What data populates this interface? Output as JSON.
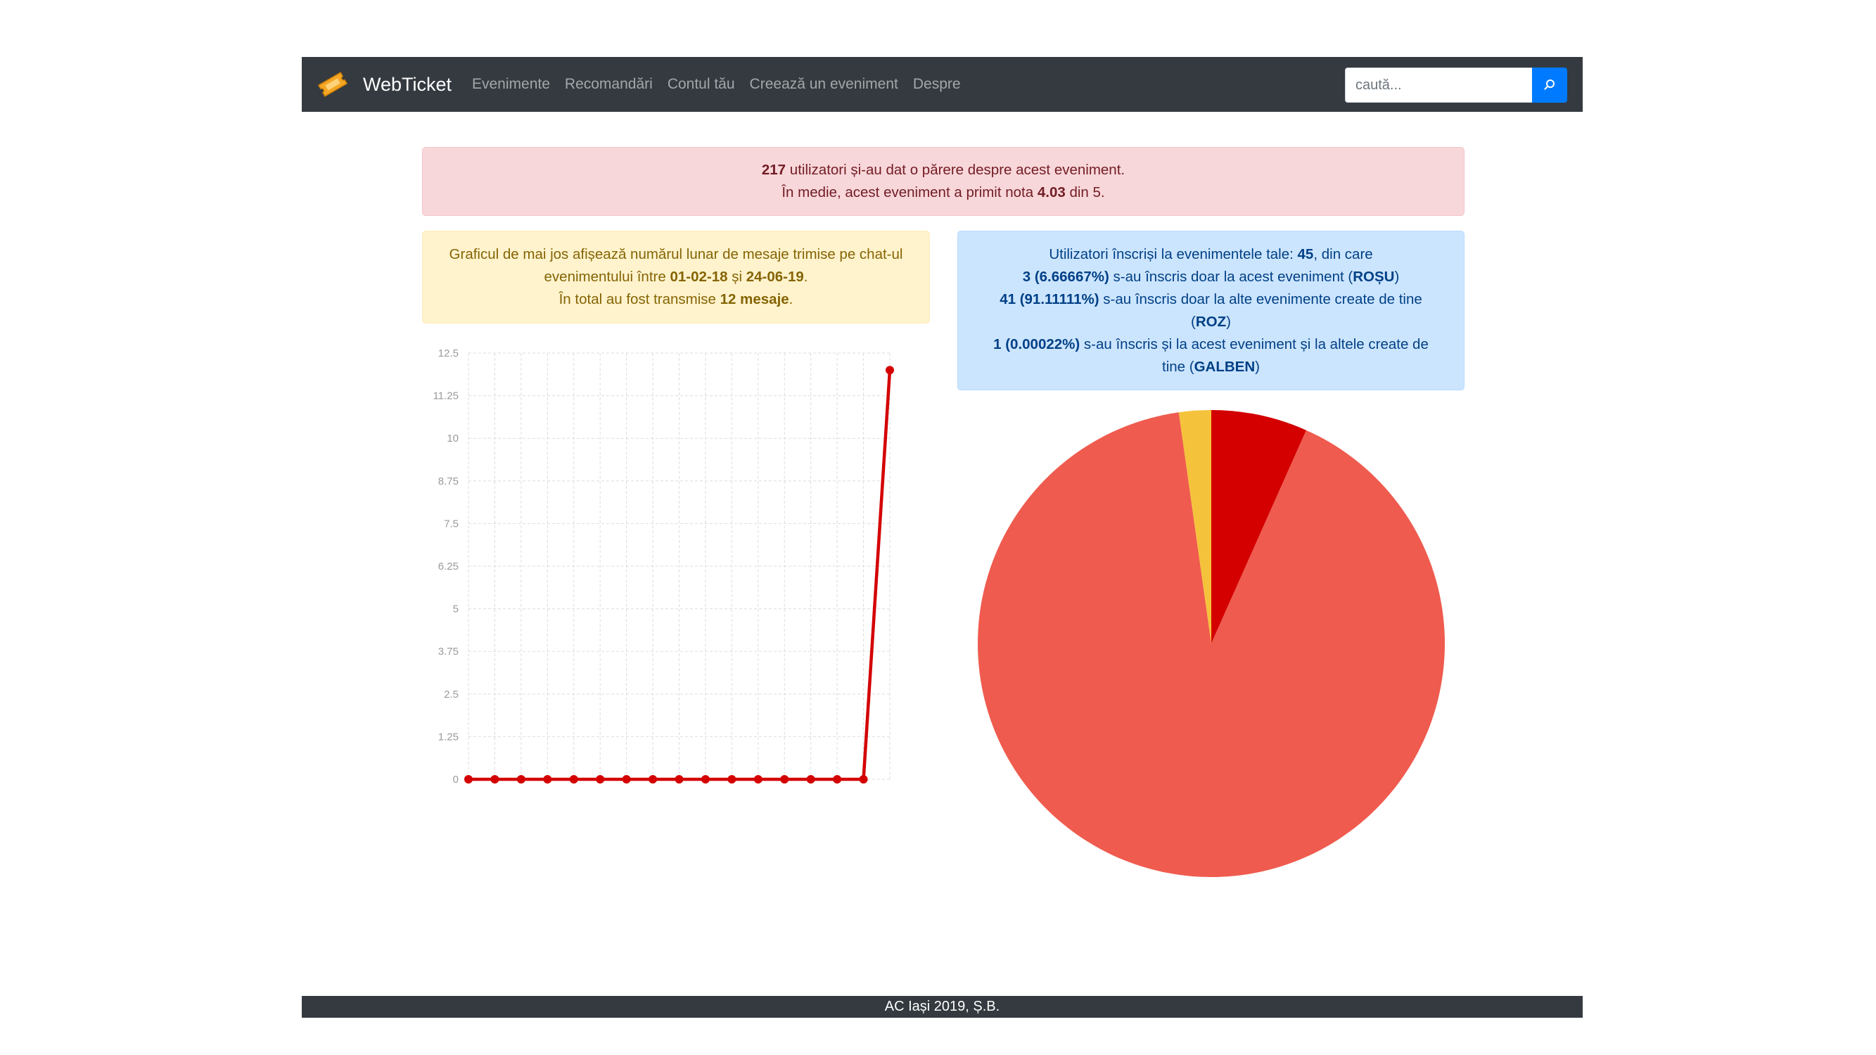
{
  "navbar": {
    "brand": "WebTicket",
    "brand_icon": "ticket-icon",
    "links": [
      "Evenimente",
      "Recomandări",
      "Contul tău",
      "Creează un eveniment",
      "Despre"
    ],
    "search": {
      "placeholder": "caută...",
      "button_icon": "search-icon"
    }
  },
  "rating_alert": {
    "users_count": "217",
    "line1_rest": " utilizatori și-au dat o părere despre acest eveniment.",
    "line2_prefix": "În medie, acest eveniment a primit nota ",
    "average": "4.03",
    "line2_suffix": " din 5."
  },
  "messages_alert": {
    "intro": "Graficul de mai jos afișează numărul lunar de mesaje trimise pe chat-ul evenimentului între ",
    "start_date": "01-02-18",
    "and": " și ",
    "end_date": "24-06-19",
    "period": ".",
    "total_prefix": "În total au fost transmise ",
    "total": "12 mesaje",
    "total_suffix": "."
  },
  "users_alert": {
    "line1_prefix": "Utilizatori înscriși la evenimentele tale: ",
    "total": "45",
    "line1_suffix": ", din care",
    "line2_value": "3 (6.66667%)",
    "line2_text": " s-au înscris doar la acest eveniment (",
    "line2_color": "ROȘU",
    "line3_value": "41 (91.11111%)",
    "line3_text": " s-au înscris doar la alte evenimente create de tine (",
    "line3_color": "ROZ",
    "line4_value": "1 (0.00022%)",
    "line4_text": " s-au înscris și la acest eveniment și la altele create de tine (",
    "line4_color": "GALBEN",
    "close": ")"
  },
  "chart_data": [
    {
      "type": "line",
      "title": "",
      "xlabel": "",
      "ylabel": "",
      "ylim": [
        0,
        12.5
      ],
      "y_ticks": [
        "0",
        "1.25",
        "2.5",
        "3.75",
        "5",
        "6.25",
        "7.5",
        "8.75",
        "10",
        "11.25",
        "12.5"
      ],
      "x": [
        1,
        2,
        3,
        4,
        5,
        6,
        7,
        8,
        9,
        10,
        11,
        12,
        13,
        14,
        15,
        16,
        17
      ],
      "series": [
        {
          "values": [
            0,
            0,
            0,
            0,
            0,
            0,
            0,
            0,
            0,
            0,
            0,
            0,
            0,
            0,
            0,
            0,
            12
          ],
          "color": "#d40000"
        }
      ],
      "grid": true,
      "legend": "none"
    },
    {
      "type": "pie",
      "slices": [
        {
          "label": "ROȘU",
          "value": 3,
          "color": "#d40000"
        },
        {
          "label": "ROZ",
          "value": 41,
          "color": "#ef5b4e"
        },
        {
          "label": "GALBEN",
          "value": 1,
          "color": "#f5c33b"
        }
      ],
      "legend": "none"
    }
  ],
  "footer": {
    "text": "AC Iași 2019, Ș.B."
  }
}
